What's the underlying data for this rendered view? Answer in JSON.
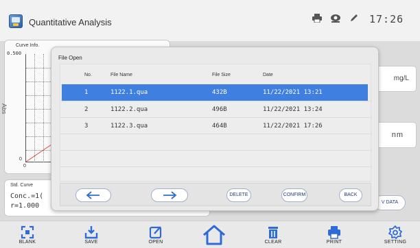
{
  "header": {
    "title": "Quantitative Analysis",
    "clock": "17:26",
    "icons": [
      "printer-icon",
      "webcam-icon",
      "edit-icon"
    ]
  },
  "curve": {
    "label": "Curve Info.",
    "y_max": "0.500",
    "y_min": "0",
    "x_min": "0",
    "y_axis": "Abs"
  },
  "concentration": {
    "unit": "mg/L"
  },
  "wavelength": {
    "unit": "nm"
  },
  "std_curve": {
    "label": "Std. Curve",
    "line1": "Conc.=1(",
    "line2": "r=1.000"
  },
  "data_button": "V DATA",
  "dialog": {
    "title": "File Open",
    "columns": {
      "no": "No.",
      "name": "File Name",
      "size": "File Size",
      "date": "Date"
    },
    "files": [
      {
        "no": "1",
        "name": "1122.1.qua",
        "size": "432B",
        "date": "11/22/2021 13:21",
        "selected": true
      },
      {
        "no": "2",
        "name": "1122.2.qua",
        "size": "496B",
        "date": "11/22/2021 13:24",
        "selected": false
      },
      {
        "no": "3",
        "name": "1122.3.qua",
        "size": "464B",
        "date": "11/22/2021 17:26",
        "selected": false
      }
    ],
    "buttons": {
      "prev_icon": "arrow-left-icon",
      "next_icon": "arrow-right-icon",
      "delete": "DELETE",
      "confirm": "CONFIRM",
      "back": "BACK"
    }
  },
  "toolbar": {
    "blank": "BLANK",
    "save": "SAVE",
    "open": "OPEN",
    "home_icon": "home-icon",
    "clear": "CLEAR",
    "print": "PRINT",
    "setting": "SETTING"
  },
  "colors": {
    "accent": "#3f7fe0",
    "icon_blue": "#2e6bd6",
    "button_text": "#1f3b78",
    "curve_red": "#e04040"
  }
}
